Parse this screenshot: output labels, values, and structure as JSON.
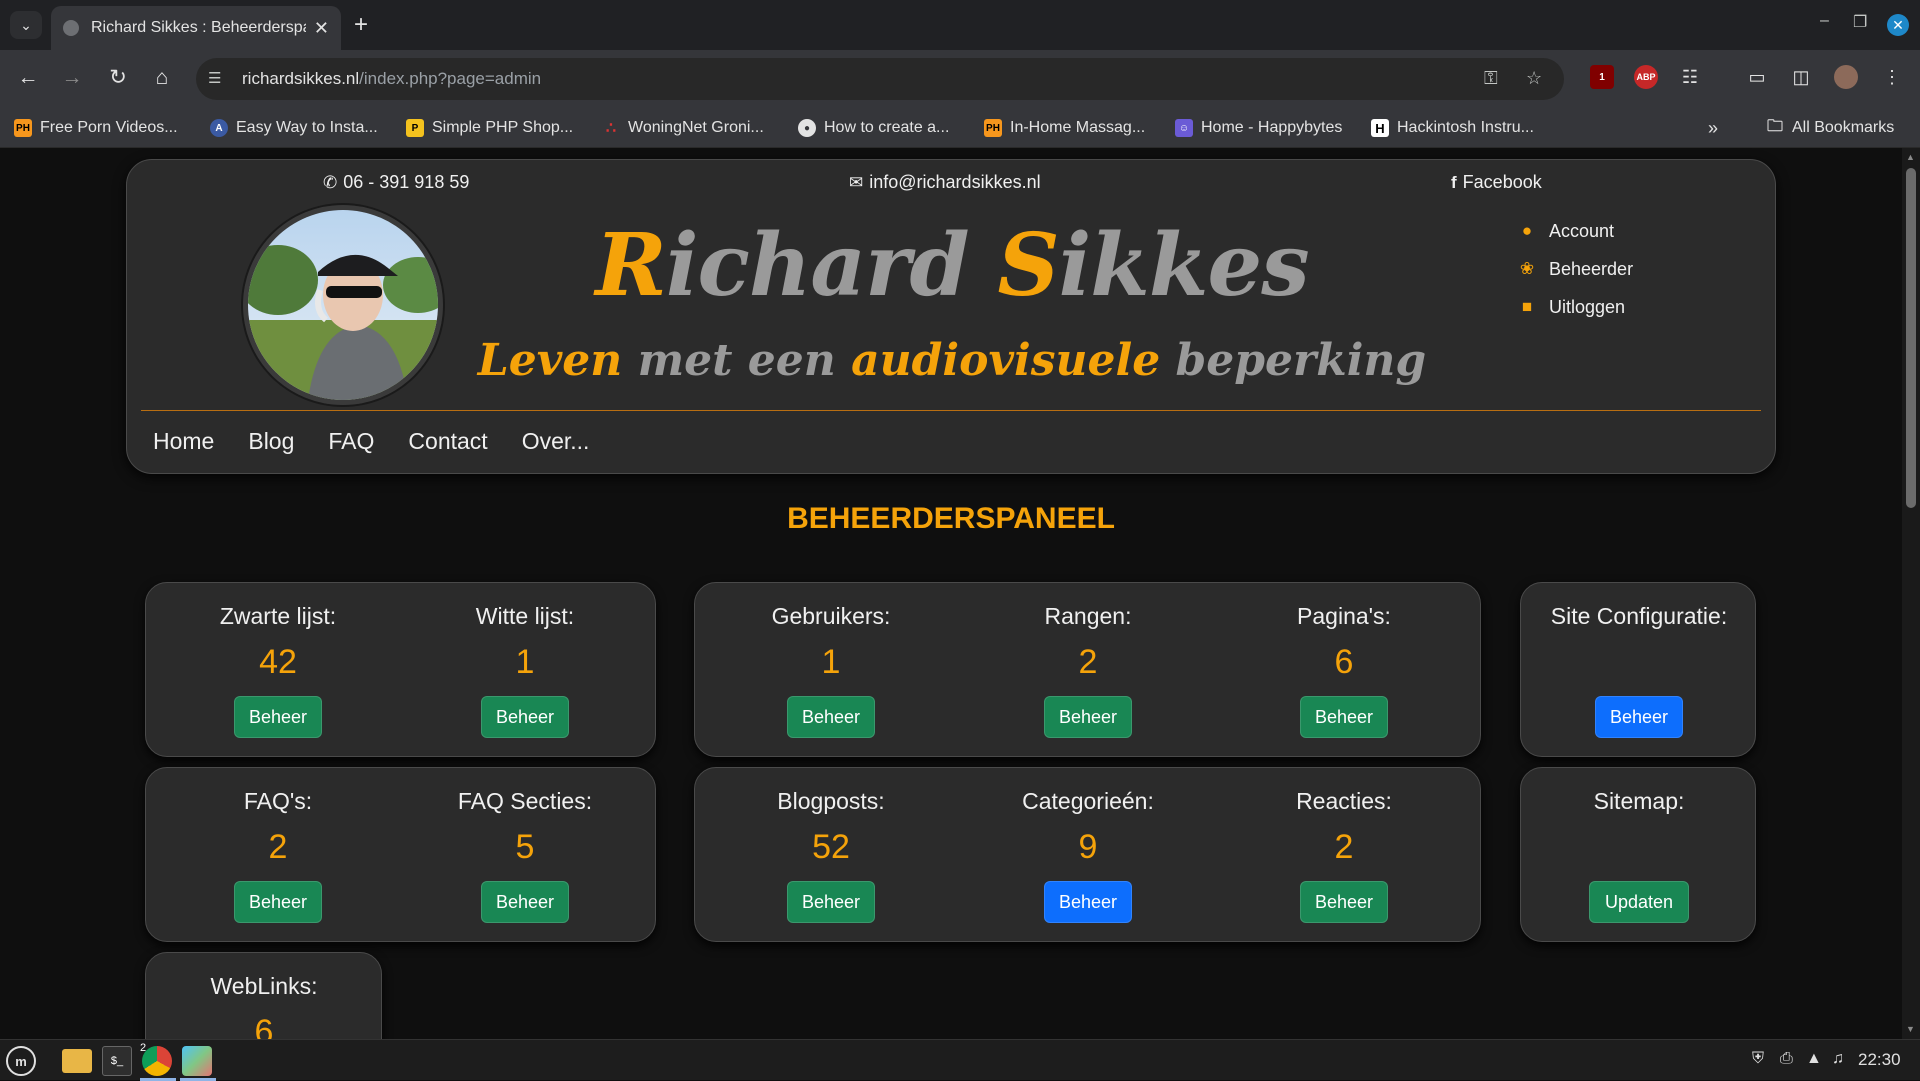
{
  "browser": {
    "tab_title": "Richard Sikkes : Beheerderspaneel",
    "url_host": "richardsikkes.nl",
    "url_path": "/index.php?page=admin",
    "bookmarks": [
      {
        "label": "Free Porn Videos...",
        "icon": "ph-icon",
        "badge": "PH"
      },
      {
        "label": "Easy Way to Insta...",
        "icon": "site-icon",
        "badge": "A"
      },
      {
        "label": "Simple PHP Shop...",
        "icon": "php-icon",
        "badge": "P"
      },
      {
        "label": "WoningNet Groni...",
        "icon": "woningnet-icon",
        "badge": "∴"
      },
      {
        "label": "How to create a...",
        "icon": "globe-icon",
        "badge": "●"
      },
      {
        "label": "In-Home Massag...",
        "icon": "ph-icon",
        "badge": "PH"
      },
      {
        "label": "Home - Happybytes",
        "icon": "happybytes-icon",
        "badge": "☺"
      },
      {
        "label": "Hackintosh Instru...",
        "icon": "h-icon",
        "badge": "H"
      }
    ],
    "all_bookmarks": "All Bookmarks",
    "ext_badge": "1",
    "abp": "ABP"
  },
  "header": {
    "phone": "06 - 391 918 59",
    "email": "info@richardsikkes.nl",
    "facebook": "Facebook",
    "title_part1": "R",
    "title_part2": "ichard ",
    "title_part3": "S",
    "title_part4": "ikkes",
    "subtitle_part1": "Leven ",
    "subtitle_part2": "met een ",
    "subtitle_part3": "audiovisuele ",
    "subtitle_part4": "beperking",
    "user_menu": [
      {
        "label": "Account",
        "icon": "user-icon"
      },
      {
        "label": "Beheerder",
        "icon": "palette-icon"
      },
      {
        "label": "Uitloggen",
        "icon": "lock-icon"
      }
    ],
    "nav": [
      "Home",
      "Blog",
      "FAQ",
      "Contact",
      "Over..."
    ]
  },
  "panel": {
    "title": "BEHEERDERSPANEEL",
    "stats": {
      "zwarte_lijst": {
        "label": "Zwarte lijst:",
        "value": "42",
        "button": "Beheer"
      },
      "witte_lijst": {
        "label": "Witte lijst:",
        "value": "1",
        "button": "Beheer"
      },
      "gebruikers": {
        "label": "Gebruikers:",
        "value": "1",
        "button": "Beheer"
      },
      "rangen": {
        "label": "Rangen:",
        "value": "2",
        "button": "Beheer"
      },
      "paginas": {
        "label": "Pagina's:",
        "value": "6",
        "button": "Beheer"
      },
      "site_config": {
        "label": "Site Configuratie:",
        "value": "",
        "button": "Beheer"
      },
      "faqs": {
        "label": "FAQ's:",
        "value": "2",
        "button": "Beheer"
      },
      "faq_secties": {
        "label": "FAQ Secties:",
        "value": "5",
        "button": "Beheer"
      },
      "blogposts": {
        "label": "Blogposts:",
        "value": "52",
        "button": "Beheer"
      },
      "categorieen": {
        "label": "Categorieén:",
        "value": "9",
        "button": "Beheer"
      },
      "reacties": {
        "label": "Reacties:",
        "value": "2",
        "button": "Beheer"
      },
      "sitemap": {
        "label": "Sitemap:",
        "value": "",
        "button": "Updaten"
      },
      "weblinks": {
        "label": "WebLinks:",
        "value": "6"
      }
    }
  },
  "taskbar": {
    "clock": "22:30",
    "chrome_badge": "2"
  },
  "colors": {
    "accent": "#f5a30a",
    "button_green": "#198754",
    "button_blue": "#0d6efd"
  }
}
